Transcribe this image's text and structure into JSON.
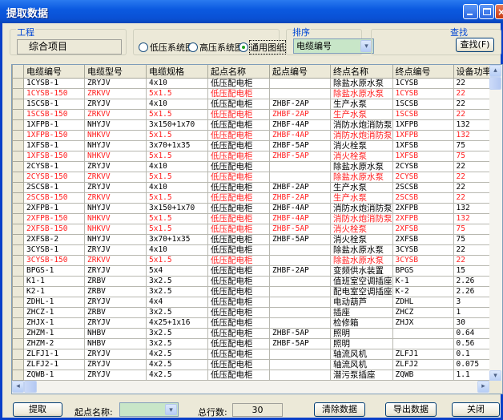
{
  "window": {
    "title": "提取数据",
    "buttons": {
      "minimize": "minimize",
      "maximize": "maximize",
      "close": "×"
    }
  },
  "project": {
    "label": "工程",
    "value": "综合项目"
  },
  "drawing_type": {
    "options": [
      {
        "label": "低压系统图",
        "selected": false
      },
      {
        "label": "高压系统图",
        "selected": false
      },
      {
        "label": "通用图纸",
        "selected": true
      }
    ]
  },
  "sort": {
    "label": "排序",
    "selected": "电缆编号",
    "arrow": "▾"
  },
  "find": {
    "label": "查找",
    "button": "查找(F)"
  },
  "grid": {
    "columns": [
      "电缆编号",
      "电缆型号",
      "电缆规格",
      "起点名称",
      "起点编号",
      "终点名称",
      "终点编号",
      "设备功率"
    ],
    "rows": [
      {
        "red": false,
        "cells": [
          "1CYSB-1",
          "ZRYJV",
          "4x10",
          "低压配电柜",
          "",
          "除盐水原水泵",
          "1CYSB",
          "22"
        ]
      },
      {
        "red": true,
        "cells": [
          "1CYSB-150",
          "ZRKVV",
          "5x1.5",
          "低压配电柜",
          "",
          "除盐水原水泵",
          "1CYSB",
          "22"
        ]
      },
      {
        "red": false,
        "cells": [
          "1SCSB-1",
          "ZRYJV",
          "4x10",
          "低压配电柜",
          "ZHBF-2AP",
          "生产水泵",
          "1SCSB",
          "22"
        ]
      },
      {
        "red": true,
        "cells": [
          "1SCSB-150",
          "ZRKVV",
          "5x1.5",
          "低压配电柜",
          "ZHBF-2AP",
          "生产水泵",
          "1SCSB",
          "22"
        ]
      },
      {
        "red": false,
        "cells": [
          "1XFPB-1",
          "NHYJV",
          "3x150+1x70",
          "低压配电柜",
          "ZHBF-4AP",
          "消防水炮消防泵",
          "1XFPB",
          "132"
        ]
      },
      {
        "red": true,
        "cells": [
          "1XFPB-150",
          "NHKVV",
          "5x1.5",
          "低压配电柜",
          "ZHBF-4AP",
          "消防水炮消防泵",
          "1XFPB",
          "132"
        ]
      },
      {
        "red": false,
        "cells": [
          "1XFSB-1",
          "NHYJV",
          "3x70+1x35",
          "低压配电柜",
          "ZHBF-5AP",
          "消火栓泵",
          "1XFSB",
          "75"
        ]
      },
      {
        "red": true,
        "cells": [
          "1XFSB-150",
          "NHKVV",
          "5x1.5",
          "低压配电柜",
          "ZHBF-5AP",
          "消火栓泵",
          "1XFSB",
          "75"
        ]
      },
      {
        "red": false,
        "cells": [
          "2CYSB-1",
          "ZRYJV",
          "4x10",
          "低压配电柜",
          "",
          "除盐水原水泵",
          "2CYSB",
          "22"
        ]
      },
      {
        "red": true,
        "cells": [
          "2CYSB-150",
          "ZRKVV",
          "5x1.5",
          "低压配电柜",
          "",
          "除盐水原水泵",
          "2CYSB",
          "22"
        ]
      },
      {
        "red": false,
        "cells": [
          "2SCSB-1",
          "ZRYJV",
          "4x10",
          "低压配电柜",
          "ZHBF-2AP",
          "生产水泵",
          "2SCSB",
          "22"
        ]
      },
      {
        "red": true,
        "cells": [
          "2SCSB-150",
          "ZRKVV",
          "5x1.5",
          "低压配电柜",
          "ZHBF-2AP",
          "生产水泵",
          "2SCSB",
          "22"
        ]
      },
      {
        "red": false,
        "cells": [
          "2XFPB-1",
          "NHYJV",
          "3x150+1x70",
          "低压配电柜",
          "ZHBF-4AP",
          "消防水炮消防泵",
          "2XFPB",
          "132"
        ]
      },
      {
        "red": true,
        "cells": [
          "2XFPB-150",
          "NHKVV",
          "5x1.5",
          "低压配电柜",
          "ZHBF-4AP",
          "消防水炮消防泵",
          "2XFPB",
          "132"
        ]
      },
      {
        "red": true,
        "cells": [
          "2XFSB-150",
          "NHKVV",
          "5x1.5",
          "低压配电柜",
          "ZHBF-5AP",
          "消火栓泵",
          "2XFSB",
          "75"
        ]
      },
      {
        "red": false,
        "cells": [
          "2XFSB-2",
          "NHYJV",
          "3x70+1x35",
          "低压配电柜",
          "ZHBF-5AP",
          "消火栓泵",
          "2XFSB",
          "75"
        ]
      },
      {
        "red": false,
        "cells": [
          "3CYSB-1",
          "ZRYJV",
          "4x10",
          "低压配电柜",
          "",
          "除盐水原水泵",
          "3CYSB",
          "22"
        ]
      },
      {
        "red": true,
        "cells": [
          "3CYSB-150",
          "ZRKVV",
          "5x1.5",
          "低压配电柜",
          "",
          "除盐水原水泵",
          "3CYSB",
          "22"
        ]
      },
      {
        "red": false,
        "cells": [
          "BPGS-1",
          "ZRYJV",
          "5x4",
          "低压配电柜",
          "ZHBF-2AP",
          "变频供水装置",
          "BPGS",
          "15"
        ]
      },
      {
        "red": false,
        "cells": [
          "K1-1",
          "ZRBV",
          "3x2.5",
          "低压配电柜",
          "",
          "值班室空调插座",
          "K-1",
          "2.26"
        ]
      },
      {
        "red": false,
        "cells": [
          "K2-1",
          "ZRBV",
          "3x2.5",
          "低压配电柜",
          "",
          "配电室空调插座",
          "K-2",
          "2.26"
        ]
      },
      {
        "red": false,
        "cells": [
          "ZDHL-1",
          "ZRYJV",
          "4x4",
          "低压配电柜",
          "",
          "电动葫芦",
          "ZDHL",
          "3"
        ]
      },
      {
        "red": false,
        "cells": [
          "ZHCZ-1",
          "ZRBV",
          "3x2.5",
          "低压配电柜",
          "",
          "插座",
          "ZHCZ",
          "1"
        ]
      },
      {
        "red": false,
        "cells": [
          "ZHJX-1",
          "ZRYJV",
          "4x25+1x16",
          "低压配电柜",
          "",
          "检修箱",
          "ZHJX",
          "30"
        ]
      },
      {
        "red": false,
        "cells": [
          "ZHZM-1",
          "NHBV",
          "3x2.5",
          "低压配电柜",
          "ZHBF-5AP",
          "照明",
          "",
          "0.64"
        ]
      },
      {
        "red": false,
        "cells": [
          "ZHZM-2",
          "NHBV",
          "3x2.5",
          "低压配电柜",
          "ZHBF-5AP",
          "照明",
          "",
          "0.56"
        ]
      },
      {
        "red": false,
        "cells": [
          "ZLFJ1-1",
          "ZRYJV",
          "4x2.5",
          "低压配电柜",
          "",
          "轴流风机",
          "ZLFJ1",
          "0.1"
        ]
      },
      {
        "red": false,
        "cells": [
          "ZLFJ2-1",
          "ZRYJV",
          "4x2.5",
          "低压配电柜",
          "",
          "轴流风机",
          "ZLFJ2",
          "0.075"
        ]
      },
      {
        "red": false,
        "cells": [
          "ZQWB-1",
          "ZRYJV",
          "4x2.5",
          "低压配电柜",
          "",
          "潜污泵插座",
          "ZQWB",
          "1.1"
        ]
      }
    ],
    "scroll_up": "▴",
    "scroll_down": "▾",
    "scroll_left": "◂",
    "scroll_right": "▸"
  },
  "footer": {
    "extract_button": "提取",
    "start_name_label": "起点名称:",
    "start_name_value": "",
    "start_name_arrow": "▾",
    "total_rows_label": "总行数:",
    "total_rows_value": "30",
    "clear_button": "清除数据",
    "export_button": "导出数据",
    "close_button": "关闭"
  },
  "colors": {
    "title_bar": "#0a50d4",
    "group_label": "#0046d5",
    "red_row_text": "#ff2020",
    "select_bg": "#c8e6c8"
  }
}
